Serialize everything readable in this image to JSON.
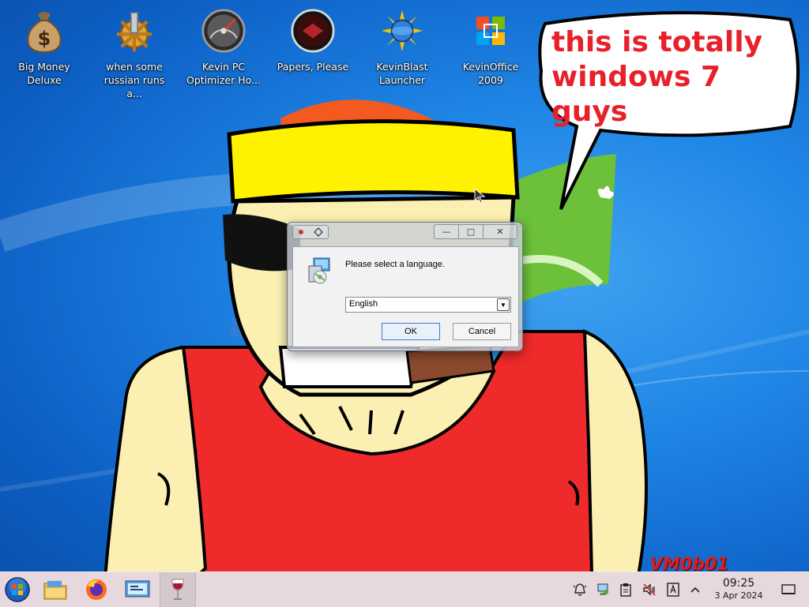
{
  "desktop": {
    "icons": [
      {
        "label_1": "Big Money",
        "label_2": "Deluxe",
        "icon": "money-bag-icon"
      },
      {
        "label_1": "when some",
        "label_2": "russian runs a...",
        "icon": "gear-pipe-icon"
      },
      {
        "label_1": "Kevin PC",
        "label_2": "Optimizer Ho...",
        "icon": "gauge-icon"
      },
      {
        "label_1": "Papers, Please",
        "label_2": "",
        "icon": "papers-please-icon"
      },
      {
        "label_1": "KevinBlast",
        "label_2": "Launcher",
        "icon": "sun-disc-icon"
      },
      {
        "label_1": "KevinOffice",
        "label_2": "2009",
        "icon": "office-logo-icon"
      }
    ],
    "speech_bubble": {
      "line_1": "this is totally",
      "line_2": "windows 7 guys",
      "color": "#e8202a"
    },
    "watermark": "VM0b01"
  },
  "dialog": {
    "prompt": "Please select a language.",
    "language_value": "English",
    "ok_label": "OK",
    "cancel_label": "Cancel"
  },
  "taskbar": {
    "items": [
      "start-orb-icon",
      "file-manager-icon",
      "firefox-icon",
      "network-manager-icon",
      "wine-glass-icon"
    ],
    "tray": [
      "notifications-bell-icon",
      "network-icon",
      "clipboard-icon",
      "volume-muted-icon",
      "keyboard-layout-icon",
      "chevron-up-icon"
    ],
    "clock_time": "09:25",
    "clock_date": "3 Apr 2024",
    "show_desktop": "show-desktop-icon"
  }
}
